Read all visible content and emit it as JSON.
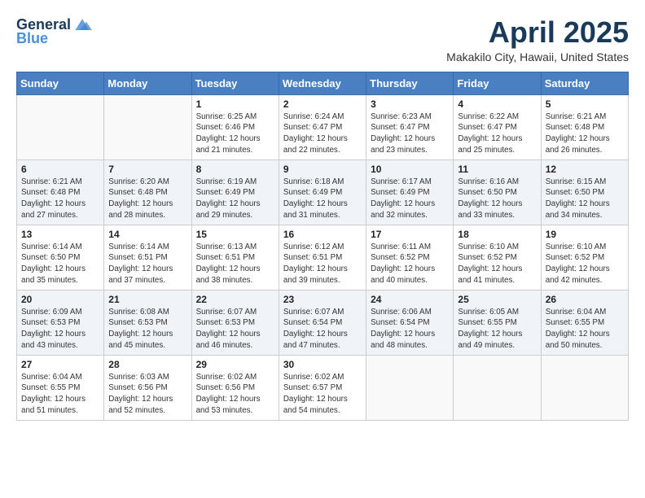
{
  "header": {
    "logo_general": "General",
    "logo_blue": "Blue",
    "month_title": "April 2025",
    "location": "Makakilo City, Hawaii, United States"
  },
  "days_of_week": [
    "Sunday",
    "Monday",
    "Tuesday",
    "Wednesday",
    "Thursday",
    "Friday",
    "Saturday"
  ],
  "weeks": [
    [
      {
        "day": "",
        "info": ""
      },
      {
        "day": "",
        "info": ""
      },
      {
        "day": "1",
        "info": "Sunrise: 6:25 AM\nSunset: 6:46 PM\nDaylight: 12 hours and 21 minutes."
      },
      {
        "day": "2",
        "info": "Sunrise: 6:24 AM\nSunset: 6:47 PM\nDaylight: 12 hours and 22 minutes."
      },
      {
        "day": "3",
        "info": "Sunrise: 6:23 AM\nSunset: 6:47 PM\nDaylight: 12 hours and 23 minutes."
      },
      {
        "day": "4",
        "info": "Sunrise: 6:22 AM\nSunset: 6:47 PM\nDaylight: 12 hours and 25 minutes."
      },
      {
        "day": "5",
        "info": "Sunrise: 6:21 AM\nSunset: 6:48 PM\nDaylight: 12 hours and 26 minutes."
      }
    ],
    [
      {
        "day": "6",
        "info": "Sunrise: 6:21 AM\nSunset: 6:48 PM\nDaylight: 12 hours and 27 minutes."
      },
      {
        "day": "7",
        "info": "Sunrise: 6:20 AM\nSunset: 6:48 PM\nDaylight: 12 hours and 28 minutes."
      },
      {
        "day": "8",
        "info": "Sunrise: 6:19 AM\nSunset: 6:49 PM\nDaylight: 12 hours and 29 minutes."
      },
      {
        "day": "9",
        "info": "Sunrise: 6:18 AM\nSunset: 6:49 PM\nDaylight: 12 hours and 31 minutes."
      },
      {
        "day": "10",
        "info": "Sunrise: 6:17 AM\nSunset: 6:49 PM\nDaylight: 12 hours and 32 minutes."
      },
      {
        "day": "11",
        "info": "Sunrise: 6:16 AM\nSunset: 6:50 PM\nDaylight: 12 hours and 33 minutes."
      },
      {
        "day": "12",
        "info": "Sunrise: 6:15 AM\nSunset: 6:50 PM\nDaylight: 12 hours and 34 minutes."
      }
    ],
    [
      {
        "day": "13",
        "info": "Sunrise: 6:14 AM\nSunset: 6:50 PM\nDaylight: 12 hours and 35 minutes."
      },
      {
        "day": "14",
        "info": "Sunrise: 6:14 AM\nSunset: 6:51 PM\nDaylight: 12 hours and 37 minutes."
      },
      {
        "day": "15",
        "info": "Sunrise: 6:13 AM\nSunset: 6:51 PM\nDaylight: 12 hours and 38 minutes."
      },
      {
        "day": "16",
        "info": "Sunrise: 6:12 AM\nSunset: 6:51 PM\nDaylight: 12 hours and 39 minutes."
      },
      {
        "day": "17",
        "info": "Sunrise: 6:11 AM\nSunset: 6:52 PM\nDaylight: 12 hours and 40 minutes."
      },
      {
        "day": "18",
        "info": "Sunrise: 6:10 AM\nSunset: 6:52 PM\nDaylight: 12 hours and 41 minutes."
      },
      {
        "day": "19",
        "info": "Sunrise: 6:10 AM\nSunset: 6:52 PM\nDaylight: 12 hours and 42 minutes."
      }
    ],
    [
      {
        "day": "20",
        "info": "Sunrise: 6:09 AM\nSunset: 6:53 PM\nDaylight: 12 hours and 43 minutes."
      },
      {
        "day": "21",
        "info": "Sunrise: 6:08 AM\nSunset: 6:53 PM\nDaylight: 12 hours and 45 minutes."
      },
      {
        "day": "22",
        "info": "Sunrise: 6:07 AM\nSunset: 6:53 PM\nDaylight: 12 hours and 46 minutes."
      },
      {
        "day": "23",
        "info": "Sunrise: 6:07 AM\nSunset: 6:54 PM\nDaylight: 12 hours and 47 minutes."
      },
      {
        "day": "24",
        "info": "Sunrise: 6:06 AM\nSunset: 6:54 PM\nDaylight: 12 hours and 48 minutes."
      },
      {
        "day": "25",
        "info": "Sunrise: 6:05 AM\nSunset: 6:55 PM\nDaylight: 12 hours and 49 minutes."
      },
      {
        "day": "26",
        "info": "Sunrise: 6:04 AM\nSunset: 6:55 PM\nDaylight: 12 hours and 50 minutes."
      }
    ],
    [
      {
        "day": "27",
        "info": "Sunrise: 6:04 AM\nSunset: 6:55 PM\nDaylight: 12 hours and 51 minutes."
      },
      {
        "day": "28",
        "info": "Sunrise: 6:03 AM\nSunset: 6:56 PM\nDaylight: 12 hours and 52 minutes."
      },
      {
        "day": "29",
        "info": "Sunrise: 6:02 AM\nSunset: 6:56 PM\nDaylight: 12 hours and 53 minutes."
      },
      {
        "day": "30",
        "info": "Sunrise: 6:02 AM\nSunset: 6:57 PM\nDaylight: 12 hours and 54 minutes."
      },
      {
        "day": "",
        "info": ""
      },
      {
        "day": "",
        "info": ""
      },
      {
        "day": "",
        "info": ""
      }
    ]
  ]
}
